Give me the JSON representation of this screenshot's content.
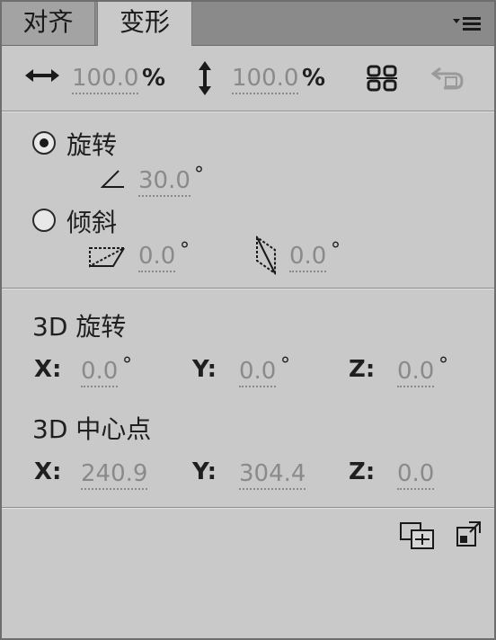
{
  "tabs": [
    {
      "label": "对齐",
      "active": false
    },
    {
      "label": "变形",
      "active": true
    }
  ],
  "scale": {
    "width_value": "100.0",
    "width_unit": "%",
    "height_value": "100.0",
    "height_unit": "%",
    "width_icon": "horizontal-scale-icon",
    "height_icon": "vertical-scale-icon",
    "constrain_icon": "constrain-link-icon",
    "reset_icon": "reset-icon"
  },
  "rotate": {
    "label": "旋转",
    "selected": true,
    "angle_value": "30.0",
    "angle_unit": "°"
  },
  "skew": {
    "label": "倾斜",
    "selected": false,
    "horizontal_value": "0.0",
    "vertical_value": "0.0",
    "unit": "°"
  },
  "rotation3d": {
    "title": "3D 旋转",
    "x_label": "X:",
    "x_value": "0.0",
    "y_label": "Y:",
    "y_value": "0.0",
    "z_label": "Z:",
    "z_value": "0.0",
    "unit": "°"
  },
  "center3d": {
    "title": "3D 中心点",
    "x_label": "X:",
    "x_value": "240.9",
    "y_label": "Y:",
    "y_value": "304.4",
    "z_label": "Z:",
    "z_value": "0.0"
  },
  "footer": {
    "duplicate_icon": "duplicate-transform-icon",
    "remove_icon": "remove-transform-icon"
  },
  "colors": {
    "panel_bg": "#c9c9c9",
    "tabbar_bg": "#8a8a8a",
    "value_text": "#8a8a8a"
  }
}
